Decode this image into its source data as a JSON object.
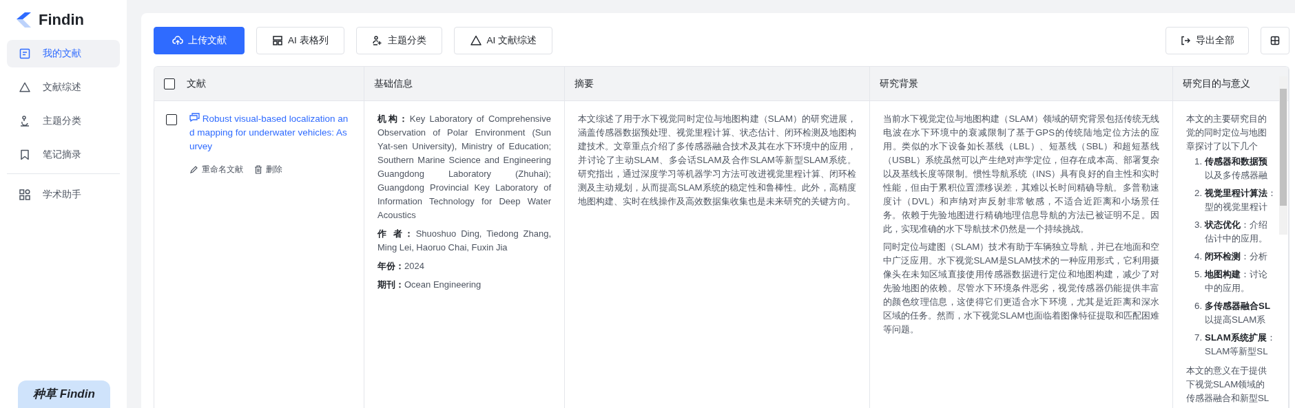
{
  "app": {
    "name": "Findin"
  },
  "sidebar": {
    "groups": [
      [
        {
          "label": "我的文献",
          "selected": true
        },
        {
          "label": "文献综述",
          "selected": false
        },
        {
          "label": "主题分类",
          "selected": false
        },
        {
          "label": "笔记摘录",
          "selected": false
        }
      ],
      [
        {
          "label": "学术助手",
          "selected": false
        }
      ]
    ],
    "promo": {
      "text": "种草 Findin"
    }
  },
  "toolbar": {
    "buttons": [
      {
        "label": "上传文献",
        "kind": "primary"
      },
      {
        "label": "AI 表格列",
        "kind": "default"
      },
      {
        "label": "主题分类",
        "kind": "default"
      },
      {
        "label": "AI 文献综述",
        "kind": "default"
      }
    ],
    "export": {
      "label": "导出全部"
    }
  },
  "table": {
    "header_checked": false,
    "columns": [
      "文献",
      "基础信息",
      "摘要",
      "研究背景",
      "研究目的与意义"
    ],
    "rows": [
      {
        "checked": false,
        "title": "Robust visual-based localization and mapping for underwater vehicles: Asurvey",
        "actions": [
          "重命名文献",
          "删除"
        ],
        "info": [
          {
            "label": "机构：",
            "value": "Key Laboratory of Comprehensive Observation of Polar Environment (Sun Yat-sen University), Ministry of Education; Southern Marine Science and Engineering Guangdong Laboratory (Zhuhai); Guangdong Provincial Key Laboratory of Information Technology for Deep Water Acoustics"
          },
          {
            "label": "作 者：",
            "value": "Shuoshuo Ding, Tiedong Zhang, Ming Lei, Haoruo Chai, Fuxin Jia"
          },
          {
            "label": "年份：",
            "value": "2024"
          },
          {
            "label": "期刊：",
            "value": "Ocean Engineering"
          }
        ],
        "abstract": "本文综述了用于水下视觉同时定位与地图构建（SLAM）的研究进展，涵盖传感器数据预处理、视觉里程计算、状态估计、闭环检测及地图构建技术。文章重点介绍了多传感器融合技术及其在水下环境中的应用，并讨论了主动SLAM、多会话SLAM及合作SLAM等新型SLAM系统。研究指出，通过深度学习等机器学习方法可改进视觉里程计算、闭环检测及主动规划，从而提高SLAM系统的稳定性和鲁棒性。此外，高精度地图构建、实时在线操作及高效数据集收集也是未来研究的关键方向。",
        "background": [
          "当前水下视觉定位与地图构建（SLAM）领域的研究背景包括传统无线电波在水下环境中的衰减限制了基于GPS的传统陆地定位方法的应用。类似的水下设备如长基线（LBL）、短基线（SBL）和超短基线（USBL）系统虽然可以产生绝对声学定位，但存在成本高、部署复杂以及基线长度等限制。惯性导航系统（INS）具有良好的自主性和实时性能，但由于累积位置漂移误差，其难以长时间精确导航。多普勒速度计（DVL）和声纳对声反射非常敏感，不适合近距离和小场景任务。依赖于先验地图进行精确地理信息导航的方法已被证明不足。因此，实现准确的水下导航技术仍然是一个持续挑战。",
          "同时定位与建图（SLAM）技术有助于车辆独立导航，并已在地面和空中广泛应用。水下视觉SLAM是SLAM技术的一种应用形式，它利用摄像头在未知区域直接使用传感器数据进行定位和地图构建，减少了对先验地图的依赖。尽管水下环境条件恶劣，视觉传感器仍能提供丰富的颜色纹理信息，这使得它们更适合水下环境，尤其是近距离和深水区域的任务。然而，水下视觉SLAM也面临着图像特征提取和匹配困难等问题。"
        ],
        "purpose": {
          "intro_lines": [
            "本文的主要研究目的",
            "觉的同时定位与地图",
            "章探讨了以下几个"
          ],
          "items": [
            {
              "number": "1.",
              "lead": "传感器和数据预",
              "cont": "以及多传感器融"
            },
            {
              "number": "2.",
              "lead": "视觉里程计算法",
              "rest": "：",
              "cont": "型的视觉里程计"
            },
            {
              "number": "3.",
              "lead": "状态优化",
              "rest": "：介绍",
              "cont": "估计中的应用。"
            },
            {
              "number": "4.",
              "lead": "闭环检测",
              "rest": "：分析"
            },
            {
              "number": "5.",
              "lead": "地图构建",
              "rest": "：讨论",
              "cont": "中的应用。"
            },
            {
              "number": "6.",
              "lead": "多传感器融合SL",
              "cont": "以提高SLAM系"
            },
            {
              "number": "7.",
              "lead": "SLAM系统扩展",
              "rest": "：",
              "cont": "SLAM等新型SL"
            }
          ],
          "outro_lines": [
            "本文的意义在于提供",
            "下视觉SLAM领域的",
            "传感器融合和新型SL"
          ]
        }
      }
    ]
  }
}
